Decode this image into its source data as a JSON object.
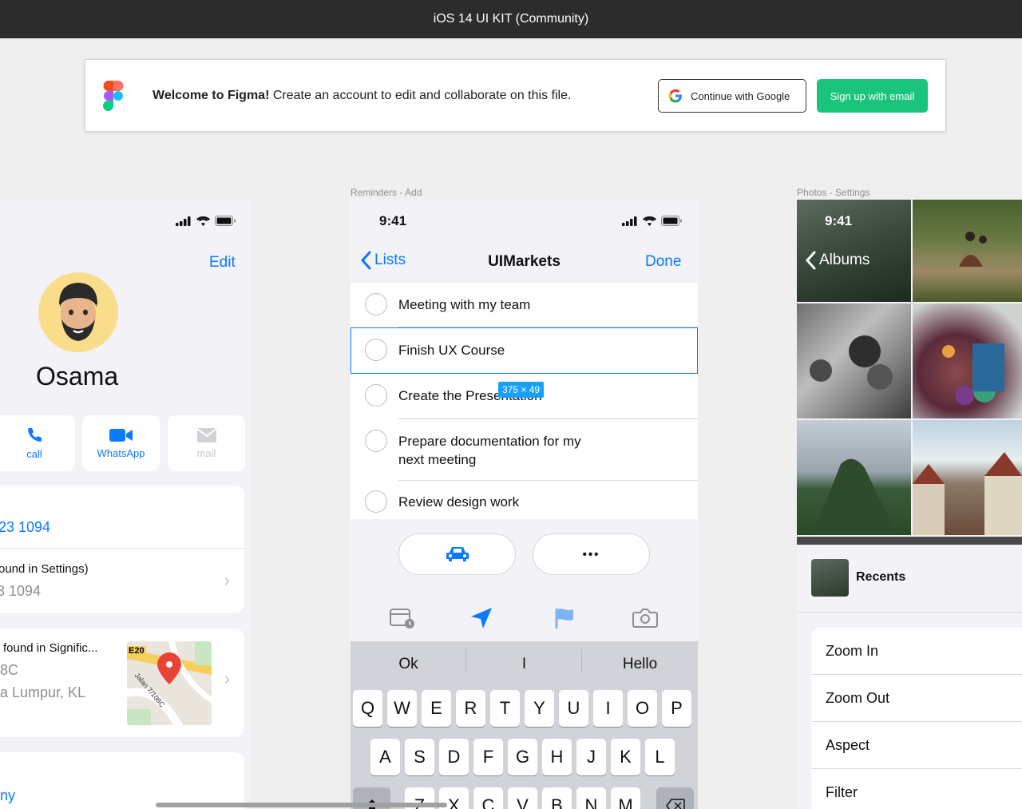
{
  "topbar": {
    "title": "iOS 14 UI KIT (Community)"
  },
  "welcome": {
    "bold": "Welcome to Figma!",
    "message": " Create an account to edit and collaborate on this file.",
    "google_button": "Continue with Google",
    "email_button": "Sign up with email"
  },
  "frames": {
    "reminders_label": "Reminders - Add",
    "photos_label": "Photos - Settings"
  },
  "contact": {
    "edit": "Edit",
    "name": "Osama",
    "actions": [
      {
        "label": "call",
        "icon": "phone-icon"
      },
      {
        "label": "WhatsApp",
        "icon": "video-icon"
      },
      {
        "label": "mail",
        "icon": "mail-icon"
      }
    ],
    "phone": "23 1094",
    "found_settings": "ound in Settings)",
    "found_settings_value": "3 1094",
    "found_significant": "found in Signific...",
    "address_line1": "8C",
    "address_line2": "a Lumpur,  KL",
    "map_road_label": "E20",
    "map_street_label": "Jalan 7/108C",
    "bottom_link": "ny"
  },
  "reminders": {
    "time": "9:41",
    "back": "Lists",
    "title": "UIMarkets",
    "done": "Done",
    "items": [
      "Meeting with my team",
      "Finish UX Course",
      "Create the Presentation",
      "Prepare documentation for my",
      "next meeting",
      "Review design work"
    ],
    "dimension_badge": "375 × 49",
    "more": "•••",
    "suggestions": [
      "Ok",
      "I",
      "Hello"
    ],
    "row1": [
      "Q",
      "W",
      "E",
      "R",
      "T",
      "Y",
      "U",
      "I",
      "O",
      "P"
    ],
    "row2": [
      "A",
      "S",
      "D",
      "F",
      "G",
      "H",
      "J",
      "K",
      "L"
    ],
    "row3": [
      "Z",
      "X",
      "C",
      "V",
      "B",
      "N",
      "M"
    ]
  },
  "photos": {
    "time": "9:41",
    "back": "Albums",
    "recents": "Recents",
    "menu": [
      "Zoom In",
      "Zoom Out",
      "Aspect",
      "Filter"
    ]
  },
  "colors": {
    "accent": "#0a7aff",
    "figma_green": "#1bc47d",
    "topbar": "#2c2c2c"
  }
}
